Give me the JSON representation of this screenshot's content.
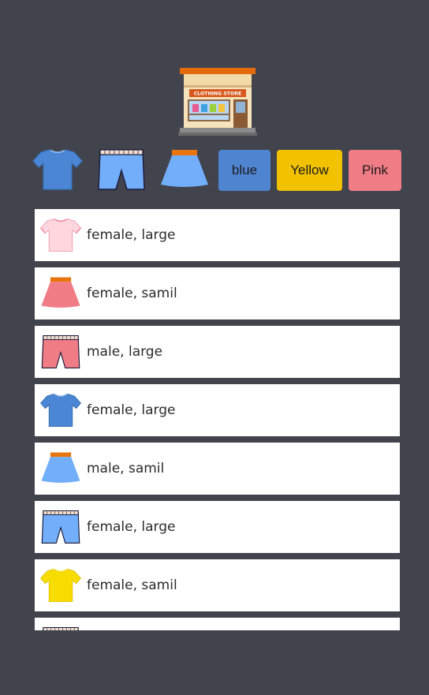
{
  "logo": {
    "icon": "clothing-store-icon",
    "sign_text": "CLOTHING STORE"
  },
  "toolbar": {
    "filters": [
      {
        "icon": "tshirt-icon",
        "color": "#4a86d4"
      },
      {
        "icon": "pants-icon",
        "color": "#73aefb"
      },
      {
        "icon": "skirt-icon",
        "color": "#73aefb"
      }
    ],
    "color_buttons": [
      {
        "label": "blue",
        "color": "#4f84d1"
      },
      {
        "label": "Yellow",
        "color": "#f2c200"
      },
      {
        "label": "Pink",
        "color": "#f07c86"
      }
    ]
  },
  "items": [
    {
      "icon": "tshirt-icon",
      "color": "#fdd6de",
      "text": "female, large"
    },
    {
      "icon": "skirt-icon",
      "color": "#f07c86",
      "text": "female, samil"
    },
    {
      "icon": "pants-icon",
      "color": "#f07c86",
      "text": "male, large"
    },
    {
      "icon": "tshirt-icon",
      "color": "#4a86d4",
      "text": "female, large"
    },
    {
      "icon": "skirt-icon",
      "color": "#73aefb",
      "text": "male, samil"
    },
    {
      "icon": "pants-icon",
      "color": "#73aefb",
      "text": "female, large"
    },
    {
      "icon": "tshirt-icon",
      "color": "#f7dc00",
      "text": "female, samil"
    },
    {
      "icon": "pants-icon",
      "color": "#f7dc00",
      "text": ""
    }
  ]
}
